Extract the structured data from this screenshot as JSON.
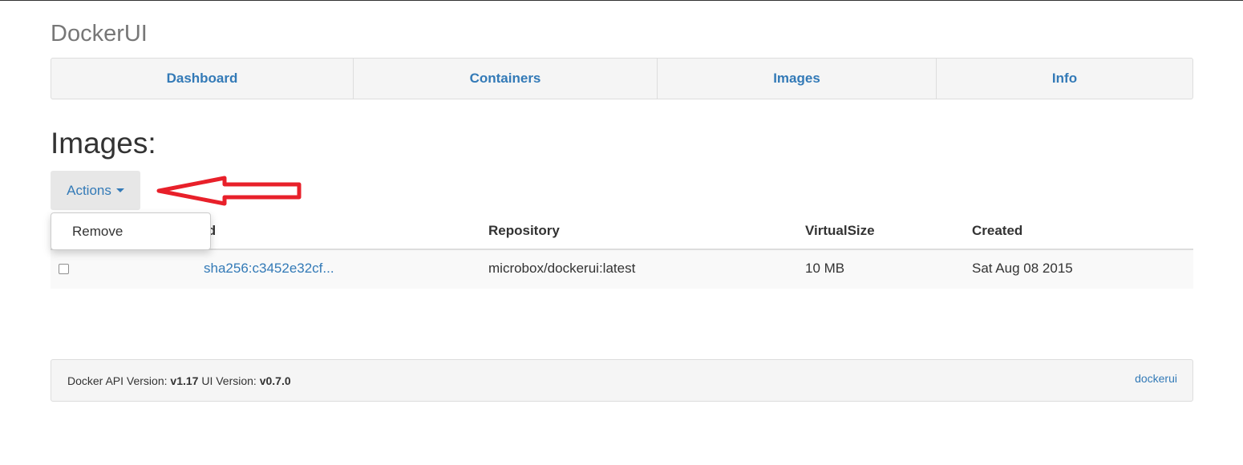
{
  "app": {
    "brand": "DockerUI"
  },
  "nav": {
    "items": [
      {
        "label": "Dashboard"
      },
      {
        "label": "Containers"
      },
      {
        "label": "Images"
      },
      {
        "label": "Info"
      }
    ]
  },
  "page": {
    "title": "Images:"
  },
  "actions": {
    "label": "Actions",
    "menu": [
      {
        "label": "Remove"
      }
    ]
  },
  "table": {
    "columns": [
      "Id",
      "Repository",
      "VirtualSize",
      "Created"
    ],
    "rows": [
      {
        "checked": false,
        "id": "sha256:c3452e32cf...",
        "repository": "microbox/dockerui:latest",
        "virtual_size": "10 MB",
        "created": "Sat Aug 08 2015"
      }
    ]
  },
  "footer": {
    "api_label": "Docker API Version:",
    "api_version": "v1.17",
    "ui_label": "UI Version:",
    "ui_version": "v0.7.0",
    "link": "dockerui"
  },
  "colors": {
    "link": "#337ab7",
    "annotation_arrow": "#e8202a",
    "nav_bg": "#f5f5f5"
  }
}
